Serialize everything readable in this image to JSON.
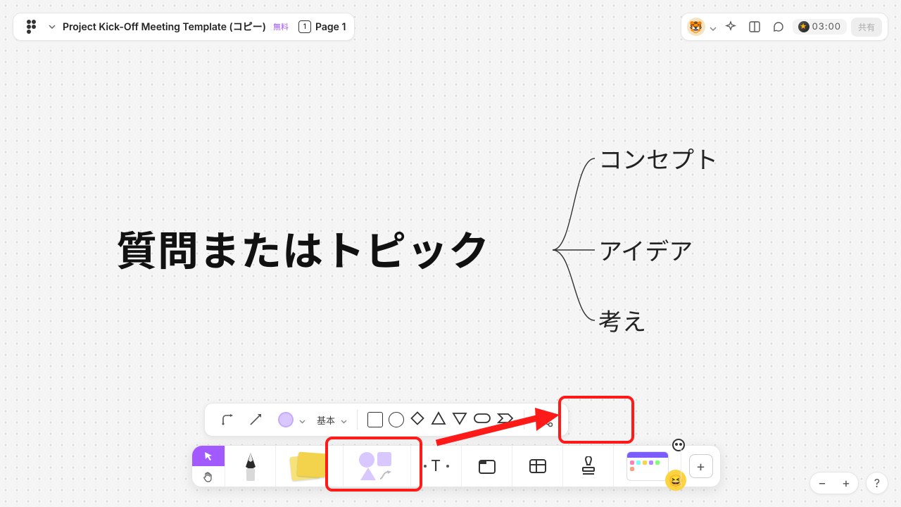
{
  "header": {
    "file_title": "Project Kick-Off Meeting Template (コピー)",
    "free_badge": "無料",
    "page_label": "Page 1",
    "page_number": "1"
  },
  "top_right": {
    "avatar_emoji": "🐯",
    "timer": "03:00",
    "share_label": "共有"
  },
  "mindmap": {
    "topic": "質問またはトピック",
    "branches": [
      "コンセプト",
      "アイデア",
      "考え"
    ]
  },
  "shape_bar": {
    "style_label": "基本",
    "connector_icons": [
      "elbow-connector-icon",
      "straight-connector-icon"
    ],
    "color": "#d9c8ff",
    "shapes": [
      "square",
      "circle",
      "diamond",
      "triangle",
      "triangle-down",
      "pill",
      "chevron",
      "mindmap"
    ]
  },
  "main_toolbar": {
    "tools": [
      "select-tool",
      "hand-tool",
      "pen-tool",
      "sticky-note-tool",
      "shapes-tool",
      "text-tool",
      "section-tool",
      "table-tool",
      "stamp-tool",
      "widgets-tool",
      "more-tool"
    ],
    "active_tool": "select-tool"
  },
  "zoom": {
    "minus": "−",
    "plus": "+",
    "help": "?"
  },
  "annotations": {
    "highlight_targets": [
      "shapes-tool",
      "mindmap-shape-button"
    ]
  }
}
